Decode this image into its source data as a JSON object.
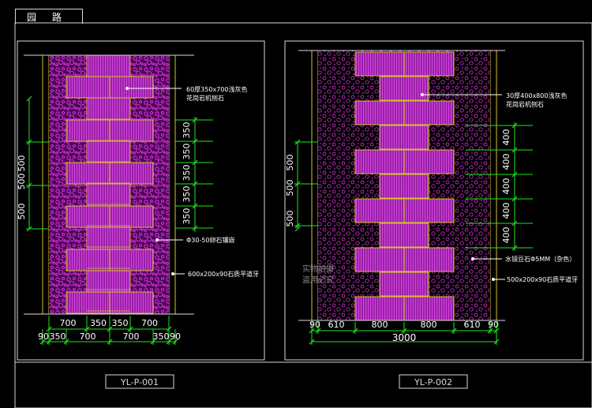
{
  "title": "园 路",
  "colors": {
    "background": "#000000",
    "frame": "#d8d8d8",
    "paver_fill": "#9a1fa6",
    "paver_edge": "#d8c22a",
    "gravel_fill": "#5a0a66",
    "gravel_dot": "#ff3cff",
    "dimension": "#1ee61e",
    "leader": "#1ee61e",
    "label_text": "#ffffff",
    "dim_text": "#ffffff"
  },
  "left_panel": {
    "caption": "YL-P-001",
    "notes": [
      "60厚350x700浅灰色\n花岗岩机刨石",
      "Φ30-50卵石镶嵌",
      "600x200x90石质平道牙"
    ],
    "vertical_dims_left": [
      "500",
      "500",
      "500"
    ],
    "vertical_dims_right": [
      "350",
      "350",
      "350",
      "350",
      "350"
    ],
    "bottom_dims_row1": [
      "700",
      "350",
      "350",
      "700"
    ],
    "bottom_dims_row2": [
      "90",
      "350",
      "700",
      "700",
      "350",
      "90"
    ]
  },
  "right_panel": {
    "caption": "YL-P-002",
    "notes": [
      "30厚400x800浅灰色\n花岗岩机刨石",
      "水镜豆石Φ5MM（杂色）",
      "500x200x90石质平道牙"
    ],
    "vertical_dims_left": [
      "500",
      "500",
      "500"
    ],
    "vertical_dims_right": [
      "400",
      "400",
      "400",
      "400",
      "400"
    ],
    "bottom_dims_row1": [
      "90",
      "610",
      "800",
      "800",
      "610",
      "90"
    ],
    "bottom_dims_row2": [
      "3000"
    ]
  },
  "watermark": [
    "实物拍摄",
    "盗用必究"
  ]
}
